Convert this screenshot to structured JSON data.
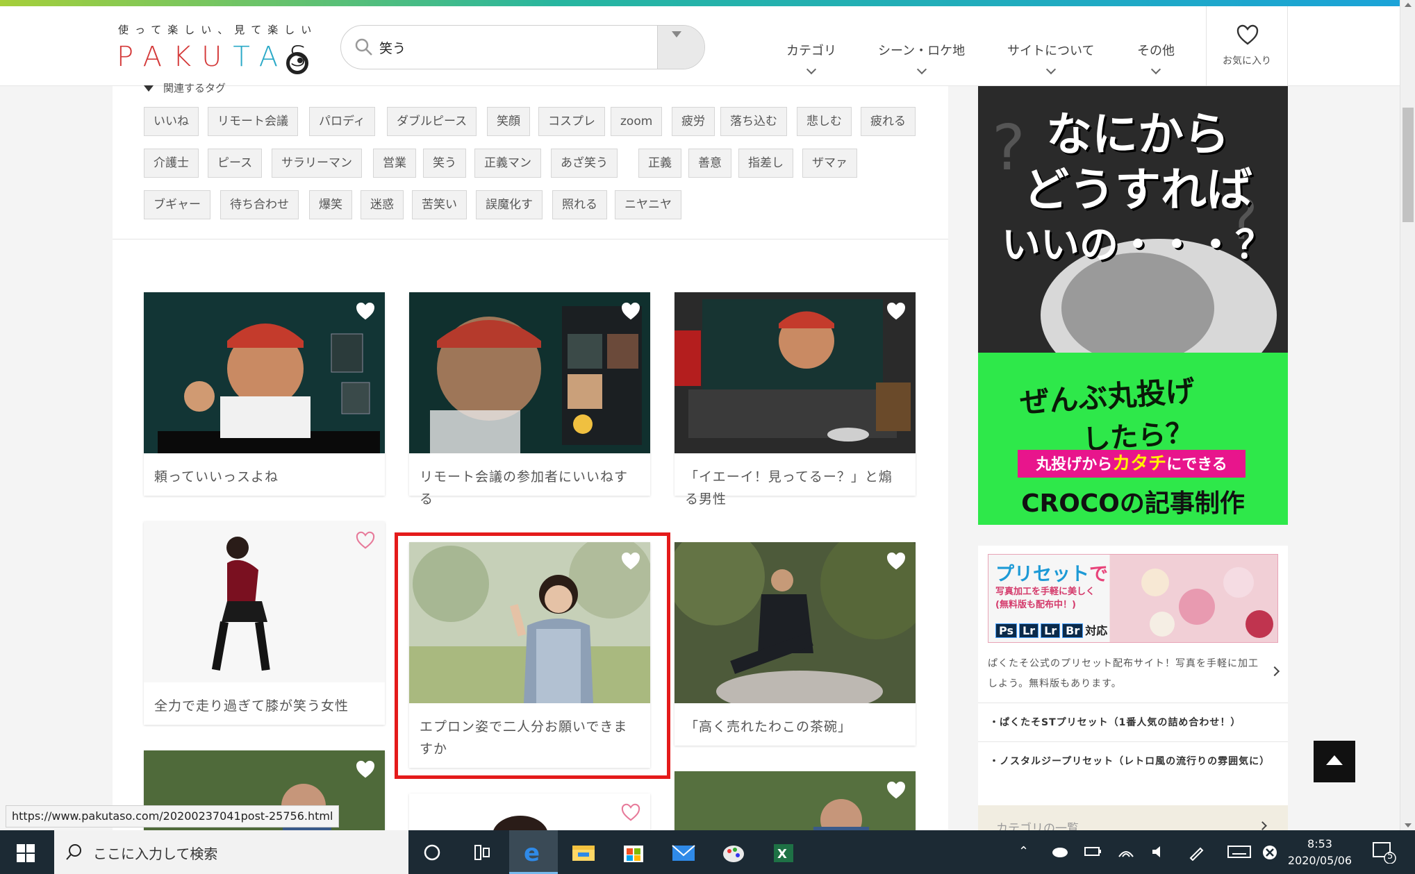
{
  "header": {
    "logo_tagline": "使って楽しい、見て楽しい",
    "logo_pre": "PAKU",
    "logo_ta": "TA",
    "logo_post": "S",
    "search_value": "笑う",
    "nav": [
      {
        "label": "カテゴリ"
      },
      {
        "label": "シーン・ロケ地"
      },
      {
        "label": "サイトについて"
      },
      {
        "label": "その他"
      }
    ],
    "favorites_label": "お気に入り"
  },
  "related": {
    "heading": "関連するタグ",
    "tags_row1": [
      "いいね",
      "リモート会議",
      "パロディ",
      "ダブルピース",
      "笑顔",
      "コスプレ",
      "zoom",
      "疲労",
      "落ち込む",
      "悲しむ",
      "疲れる"
    ],
    "tags_row2": [
      "介護士",
      "ピース",
      "サラリーマン",
      "営業",
      "笑う",
      "正義マン",
      "あざ笑う",
      "正義",
      "善意",
      "指差し",
      "ザマァ"
    ],
    "tags_row3": [
      "ブギャー",
      "待ち合わせ",
      "爆笑",
      "迷惑",
      "苦笑い",
      "誤魔化す",
      "照れる",
      "ニヤニヤ"
    ]
  },
  "cards": [
    {
      "caption": "頼っていいっスよね"
    },
    {
      "caption": "リモート会議の参加者にいいねする"
    },
    {
      "caption": "「イエーイ！見ってるー？」と煽る男性"
    },
    {
      "caption": "全力で走り過ぎて膝が笑う女性"
    },
    {
      "caption": "エプロン姿で二人分お願いできますか"
    },
    {
      "caption": "「高く売れたわこの茶碗」"
    }
  ],
  "sidebar": {
    "ad_title_l1": "なにから",
    "ad_title_l2": "どうすれば",
    "ad_title_l3": "いいの・・・？",
    "ad_green_l1": "ぜんぶ丸投げ",
    "ad_green_l2": "したら？",
    "ad_bar_pre": "丸投げから",
    "ad_bar_em": "カタチ",
    "ad_bar_post": "にできる",
    "ad_green_l3": "CROCOの記事制作",
    "preset_title_pre": "プリセット",
    "preset_title_post": "で",
    "preset_sub_l1": "写真加工を手軽に美しく",
    "preset_sub_l2": "(無料版も配布中！)",
    "preset_logos": [
      "Ps",
      "Lr",
      "Lr",
      "Br"
    ],
    "preset_logos_suffix": "対応",
    "preset_text": "ぱくたそ公式のプリセット配布サイト！写真を手軽に加工しよう。無料版もあります。",
    "preset_links": [
      "・ぱくたそSTプリセット（1番人気の詰め合わせ！）",
      "・ノスタルジープリセット（レトロ風の流行りの雰囲気に）"
    ],
    "category_list": "カテゴリの一覧"
  },
  "status_url": "https://www.pakutaso.com/20200237041post-25756.html",
  "taskbar": {
    "search_placeholder": "ここに入力して検索",
    "time": "8:53",
    "date": "2020/05/06",
    "notifications": "5"
  },
  "colors": {
    "accent_red": "#e41b1b",
    "ad_green": "#2ee84a",
    "taskbar": "#1c2a34"
  }
}
